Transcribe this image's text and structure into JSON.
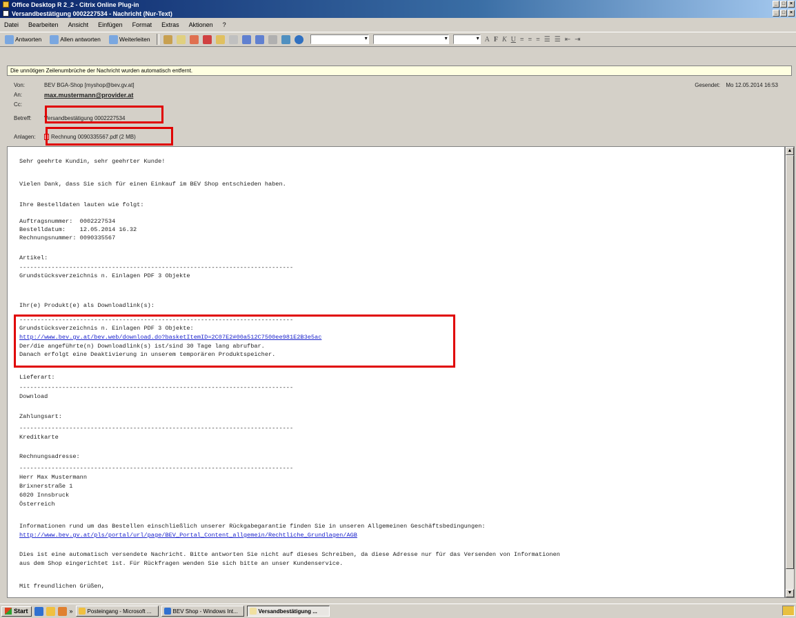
{
  "windows": {
    "outer_title": "Office Desktop R 2_2 - Citrix Online Plug-in",
    "inner_title": "Versandbestätigung 0002227534 - Nachricht (Nur-Text)"
  },
  "menu": [
    "Datei",
    "Bearbeiten",
    "Ansicht",
    "Einfügen",
    "Format",
    "Extras",
    "Aktionen",
    "?"
  ],
  "toolbar": {
    "reply": "Antworten",
    "reply_all": "Allen antworten",
    "forward": "Weiterleiten"
  },
  "infobar": "Die unnötigen Zeilenumbrüche der Nachricht wurden automatisch entfernt.",
  "header": {
    "from_label": "Von:",
    "from_value": "BEV BGA-Shop [myshop@bev.gv.at]",
    "to_label": "An:",
    "to_value": "max.mustermann@provider.at",
    "cc_label": "Cc:",
    "cc_value": "",
    "subject_label": "Betreff:",
    "subject_value": "Versandbestätigung 0002227534",
    "attach_label": "Anlagen:",
    "attach_value": "Rechnung 0090335567.pdf (2 MB)",
    "sent_label": "Gesendet:",
    "sent_value": "Mo 12.05.2014 16:53"
  },
  "body": {
    "l01": "Sehr geehrte Kundin, sehr geehrter Kunde!",
    "l02": "Vielen Dank, dass Sie sich für einen Einkauf im BEV Shop entschieden haben.",
    "l03": "Ihre Bestelldaten lauten wie folgt:",
    "l04": "Auftragsnummer:  0002227534",
    "l05": "Bestelldatum:    12.05.2014 16.32",
    "l06": "Rechnungsnummer: 0090335567",
    "l07": "Artikel:",
    "l08": "-----------------------------------------------------------------------------",
    "l09": "Grundstücksverzeichnis n. Einlagen PDF 3 Objekte",
    "l10": "Ihr(e) Produkt(e) als Downloadlink(s):",
    "l11": "-----------------------------------------------------------------------------",
    "l12": "Grundstücksverzeichnis n. Einlagen PDF 3 Objekte:",
    "l13": "http://www.bev.gv.at/bev.web/download.do?basketItemID=2C07E2#00a512C7500ee981E2B3e5ac",
    "l14": "Der/die angeführte(n) Downloadlink(s) ist/sind 30 Tage lang abrufbar.",
    "l15": "Danach erfolgt eine Deaktivierung in unserem temporären Produktspeicher.",
    "l16": "Lieferart:",
    "l17": "-----------------------------------------------------------------------------",
    "l18": "Download",
    "l19": "Zahlungsart:",
    "l20": "-----------------------------------------------------------------------------",
    "l21": "Kreditkarte",
    "l22": "Rechnungsadresse:",
    "l23": "-----------------------------------------------------------------------------",
    "l24": "Herr Max Mustermann",
    "l25": "Brixnerstraße 1",
    "l26": "6020 Innsbruck",
    "l27": "Österreich",
    "l28": "Informationen rund um das Bestellen einschließlich unserer Rückgabegarantie finden Sie in unseren Allgemeinen Geschäftsbedingungen:",
    "l29": "http://www.bev.gv.at/pls/portal/url/page/BEV_Portal_Content_allgemein/Rechtliche_Grundlagen/AGB",
    "l30": "Dies ist eine automatisch versendete Nachricht. Bitte antworten Sie nicht auf dieses Schreiben, da diese Adresse nur für das Versenden von Informationen",
    "l31": "aus dem Shop eingerichtet ist. Für Rückfragen wenden Sie sich bitte an unser Kundenservice.",
    "l32": "Mit freundlichen Grüßen,"
  },
  "taskbar": {
    "start": "Start",
    "task1": "Posteingang - Microsoft ...",
    "task2": "BEV Shop - Windows Int...",
    "task3": "Versandbestätigung ..."
  }
}
